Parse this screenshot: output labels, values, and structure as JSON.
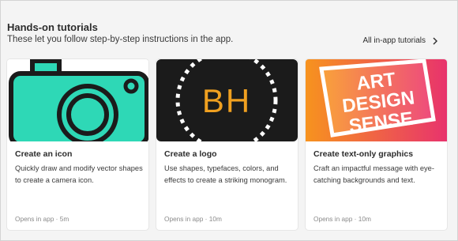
{
  "section": {
    "title": "Hands-on tutorials",
    "subtitle": "These let you follow step-by-step instructions in the app.",
    "all_link": "All in-app tutorials"
  },
  "cards": [
    {
      "title": "Create an icon",
      "description": "Quickly draw and modify vector shapes to create a camera icon.",
      "meta": "Opens in app  ·  5m",
      "thumbnail": "camera-icon"
    },
    {
      "title": "Create a logo",
      "description": "Use shapes, typefaces, colors, and effects to create a striking monogram.",
      "meta": "Opens in app  ·  10m",
      "thumbnail": "bh-monogram",
      "thumb_text": "BH"
    },
    {
      "title": "Create text-only graphics",
      "description": "Craft an impactful message with eye-catching backgrounds and text.",
      "meta": "Opens in app  ·  10m",
      "thumbnail": "art-design-sense",
      "thumb_lines": [
        "ART",
        "DESIGN",
        "SENSE"
      ]
    }
  ],
  "colors": {
    "camera_teal": "#2ed8b6",
    "monogram_orange": "#f0a020",
    "gradient_start": "#f7931e",
    "gradient_end": "#e8336d"
  }
}
